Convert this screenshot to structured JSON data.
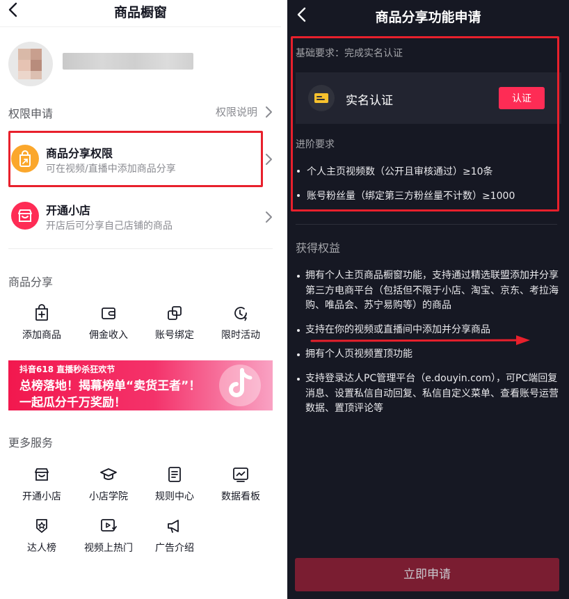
{
  "left": {
    "title": "商品橱窗",
    "permission_section": "权限申请",
    "permission_explain": "权限说明",
    "rows": [
      {
        "title": "商品分享权限",
        "subtitle": "可在视频/直播中添加商品分享",
        "icon": "share-bag-icon",
        "color": "#fba72c"
      },
      {
        "title": "开通小店",
        "subtitle": "开店后可分享自己店铺的商品",
        "icon": "shop-icon",
        "color": "#fe2c55"
      }
    ],
    "share_section": "商品分享",
    "share_items": [
      {
        "label": "添加商品",
        "icon": "add-product-icon"
      },
      {
        "label": "佣金收入",
        "icon": "wallet-icon"
      },
      {
        "label": "账号绑定",
        "icon": "link-account-icon"
      },
      {
        "label": "限时活动",
        "icon": "timer-icon"
      }
    ],
    "banner": {
      "tag": "抖音618 直播秒杀狂欢节",
      "line1": "总榜落地！揭幕榜单“卖货王者”！",
      "line2": "一起瓜分千万奖励！"
    },
    "more_section": "更多服务",
    "more_items": [
      {
        "label": "开通小店",
        "icon": "store-icon"
      },
      {
        "label": "小店学院",
        "icon": "graduation-cap-icon"
      },
      {
        "label": "规则中心",
        "icon": "document-icon"
      },
      {
        "label": "数据看板",
        "icon": "chart-board-icon"
      },
      {
        "label": "达人榜",
        "icon": "badge-icon"
      },
      {
        "label": "视频上热门",
        "icon": "video-hot-icon"
      },
      {
        "label": "广告介绍",
        "icon": "megaphone-icon"
      }
    ]
  },
  "right": {
    "title": "商品分享功能申请",
    "basic_req": "基础要求：完成实名认证",
    "verify_label": "实名认证",
    "verify_button": "认证",
    "advanced_req": "进阶要求",
    "requirements": [
      "个人主页视频数（公开且审核通过）≥10条",
      "账号粉丝量（绑定第三方粉丝量不计数）≥1000"
    ],
    "benefits_title": "获得权益",
    "benefits": [
      "拥有个人主页商品橱窗功能，支持通过精选联盟添加并分享第三方电商平台（包括但不限于小店、淘宝、京东、考拉海购、唯品会、苏宁易购等）的商品",
      "支持在你的视频或直播间中添加并分享商品",
      "拥有个人页视频置顶功能",
      "支持登录达人PC管理平台（e.douyin.com），可PC端回复消息、设置私信自动回复、私信自定义菜单、查看账号运营数据、置顶评论等"
    ],
    "apply_button": "立即申请"
  },
  "colors": {
    "accent": "#fe2c55",
    "highlight_box": "#e8202c",
    "dark_bg": "#161823"
  }
}
